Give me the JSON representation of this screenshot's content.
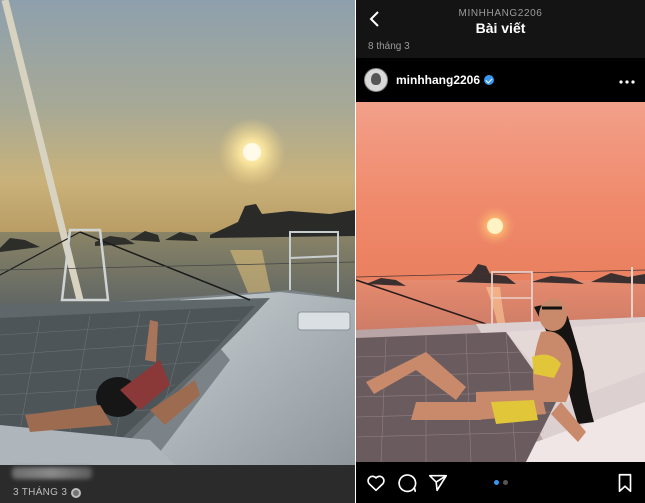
{
  "left_post": {
    "date": "3 THÁNG 3",
    "visibility_icon": "globe-icon"
  },
  "right_post": {
    "header": {
      "username_caption": "MINHHANG2206",
      "title": "Bài viết",
      "back_icon": "chevron-left-icon"
    },
    "date": "8 tháng 3",
    "author": {
      "username": "minhhang2206",
      "verified": true,
      "more_icon": "more-horizontal-icon"
    },
    "actions": {
      "like_icon": "heart-icon",
      "comment_icon": "comment-icon",
      "share_icon": "send-icon",
      "save_icon": "bookmark-icon"
    },
    "carousel": {
      "count": 2,
      "active": 1
    }
  },
  "colors": {
    "instagram_blue": "#3897f0",
    "sunset_orange": "#f08a6c"
  }
}
